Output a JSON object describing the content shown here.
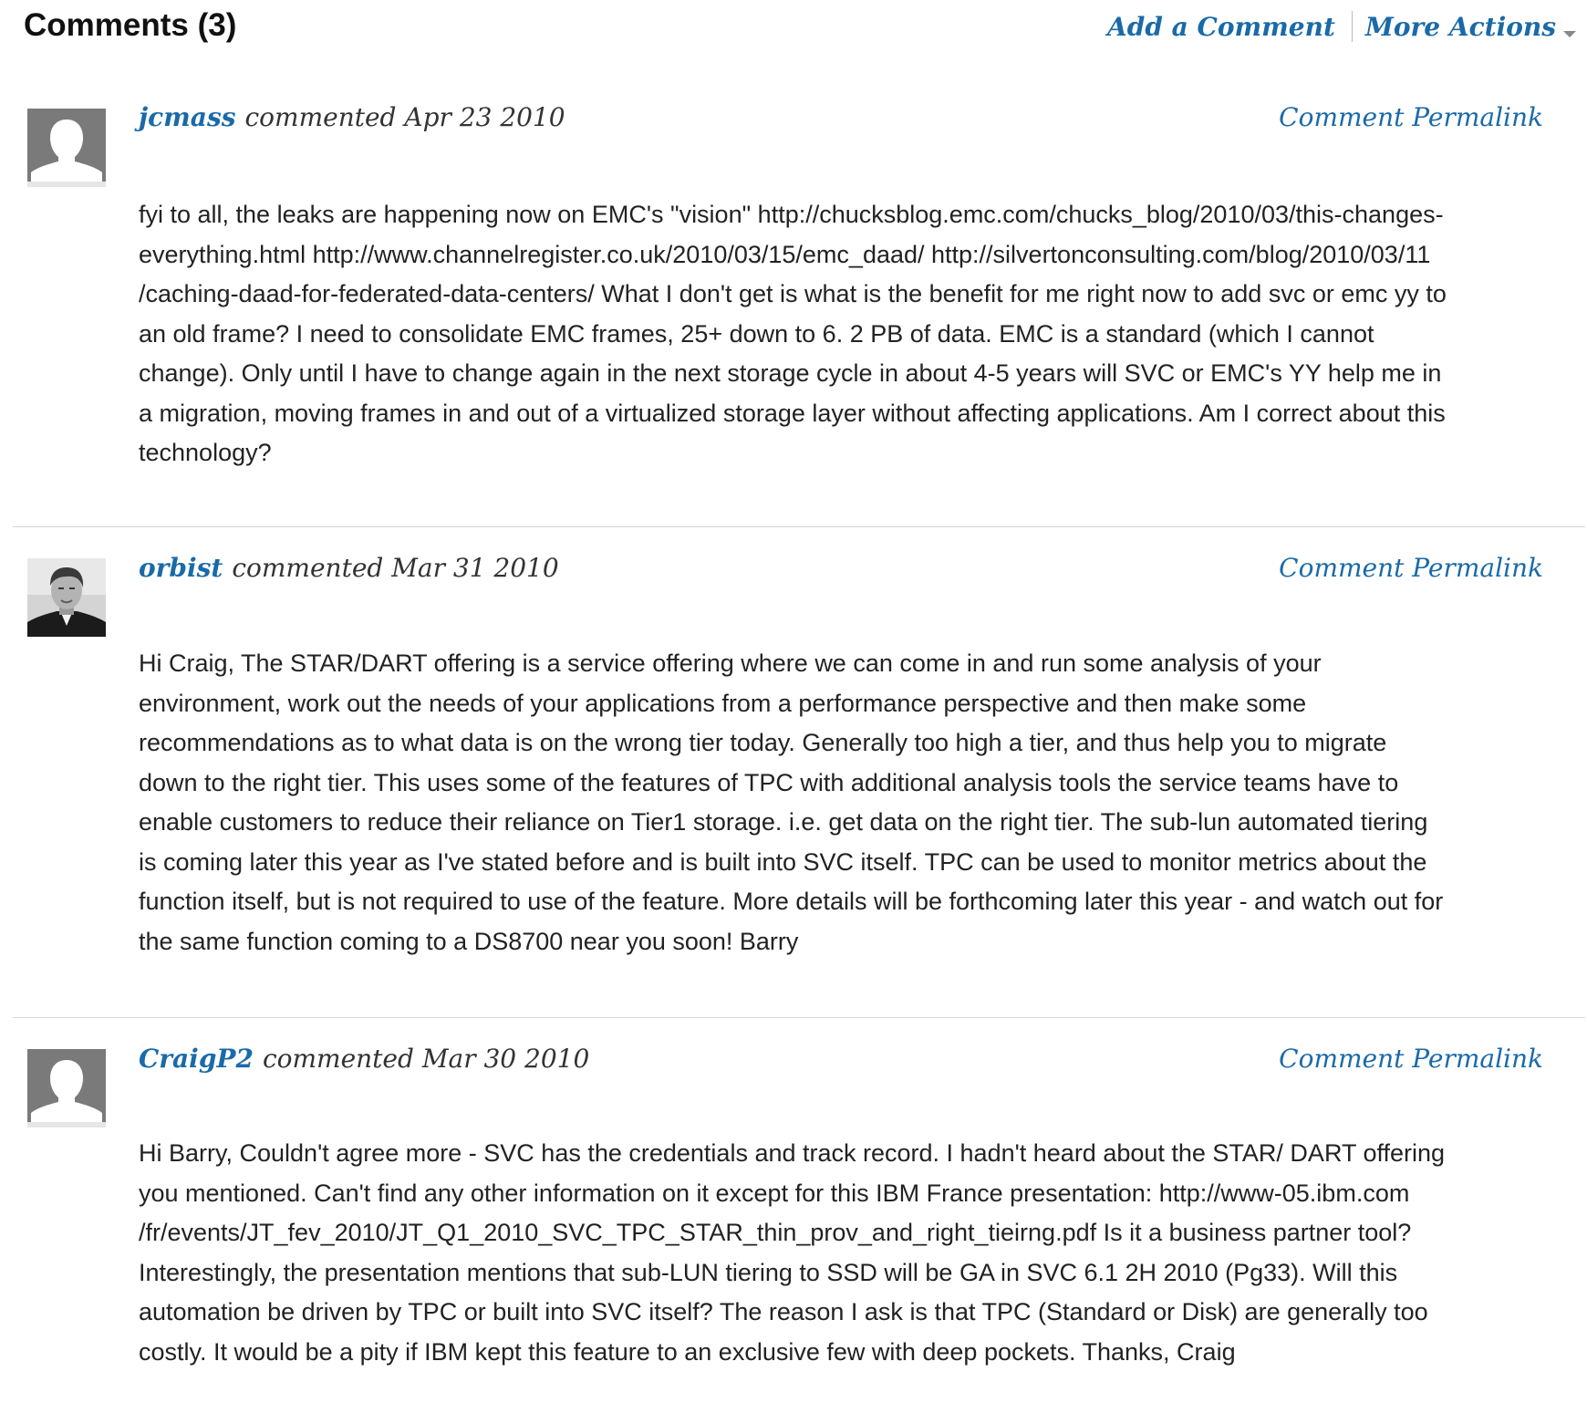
{
  "header": {
    "title": "Comments (3)",
    "add_comment": "Add a Comment",
    "more_actions": "More Actions"
  },
  "comments": [
    {
      "author": "jcmass",
      "verb": "commented",
      "date": "Apr 23 2010",
      "permalink": "Comment Permalink",
      "avatar": "default-avatar-icon",
      "lines": [
        "fyi to all, the leaks are happening now on EMC's \"vision\" http://chucksblog.emc.com/chucks_blog/2010/03/this-changes-",
        "everything.html http://www.channelregister.co.uk/2010/03/15/emc_daad/ http://silvertonconsulting.com/blog/2010/03/11",
        "/caching-daad-for-federated-data-centers/ What I don't get is what is the benefit for me right now to add svc or emc yy to",
        "an old frame? I need to consolidate EMC frames, 25+ down to 6. 2 PB of data. EMC is a standard (which I cannot",
        "change). Only until I have to change again in the next storage cycle in about 4-5 years will SVC or EMC's YY help me in",
        "a migration, moving frames in and out of a virtualized storage layer without affecting applications. Am I correct about this",
        "technology?"
      ]
    },
    {
      "author": "orbist",
      "verb": "commented",
      "date": "Mar 31 2010",
      "permalink": "Comment Permalink",
      "avatar": "user-photo",
      "lines": [
        "Hi Craig, The STAR/DART offering is a service offering where we can come in and run some analysis of your",
        "environment, work out the needs of your applications from a performance perspective and then make some",
        "recommendations as to what data is on the wrong tier today. Generally too high a tier, and thus help you to migrate",
        "down to the right tier. This uses some of the features of TPC with additional analysis tools the service teams have to",
        "enable customers to reduce their reliance on Tier1 storage. i.e. get data on the right tier. The sub-lun automated tiering",
        "is coming later this year as I've stated before and is built into SVC itself. TPC can be used to monitor metrics about the",
        "function itself, but is not required to use of the feature. More details will be forthcoming later this year - and watch out for",
        "the same function coming to a DS8700 near you soon! Barry"
      ]
    },
    {
      "author": "CraigP2",
      "verb": "commented",
      "date": "Mar 30 2010",
      "permalink": "Comment Permalink",
      "avatar": "default-avatar-icon",
      "lines": [
        "Hi Barry, Couldn't agree more - SVC has the credentials and track record. I hadn't heard about the STAR/ DART offering",
        "you mentioned. Can't find any other information on it except for this IBM France presentation: http://www-05.ibm.com",
        "/fr/events/JT_fev_2010/JT_Q1_2010_SVC_TPC_STAR_thin_prov_and_right_tieirng.pdf Is it a business partner tool?",
        "Interestingly, the presentation mentions that sub-LUN tiering to SSD will be GA in SVC 6.1 2H 2010 (Pg33). Will this",
        "automation be driven by TPC or built into SVC itself? The reason I ask is that TPC (Standard or Disk) are generally too",
        "costly. It would be a pity if IBM kept this feature to an exclusive few with deep pockets. Thanks, Craig"
      ]
    }
  ]
}
